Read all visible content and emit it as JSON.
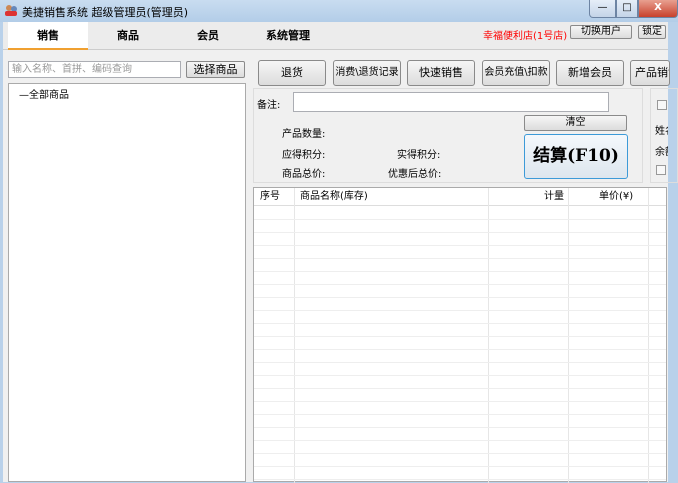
{
  "window": {
    "title": "美捷销售系统   超级管理员(管理员)",
    "minimize": "—",
    "maximize": "□",
    "close": "X"
  },
  "tabs": [
    {
      "label": "销售"
    },
    {
      "label": "商品"
    },
    {
      "label": "会员"
    },
    {
      "label": "系统管理"
    }
  ],
  "header": {
    "store": "幸福便利店(1号店)",
    "switch_user": "切换用户",
    "lock": "锁定",
    "store_color": "#ff0000"
  },
  "search": {
    "placeholder": "输入名称、首拼、编码查询",
    "value": "",
    "select_button": "选择商品"
  },
  "tree": {
    "root": "—全部商品"
  },
  "toolbar": [
    "退货",
    "消费\\退货记录",
    "快速销售",
    "会员充值\\扣款",
    "新增会员",
    "产品销售"
  ],
  "info": {
    "remark_label": "备注:",
    "remark_value": "",
    "quantity": "产品数量:",
    "points_due": "应得积分:",
    "points_actual": "实得积分:",
    "total": "商品总价:",
    "discounted_total": "优惠后总价:",
    "clear": "清空",
    "checkout": "结算(F10)"
  },
  "member": {
    "name": "姓名",
    "balance": "余额"
  },
  "table": {
    "columns": [
      "序号",
      "商品名称(库存)",
      "计量",
      "单价(¥)"
    ],
    "rows": []
  }
}
